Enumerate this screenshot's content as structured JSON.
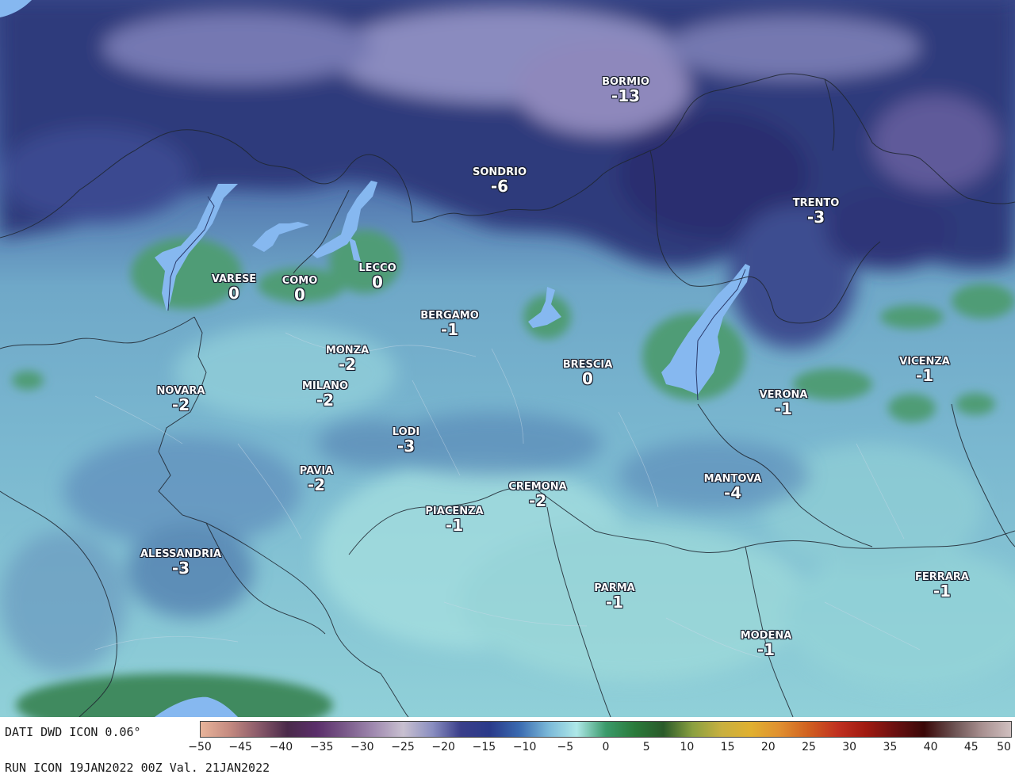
{
  "map": {
    "cities": [
      {
        "name": "BORMIO",
        "value": "-13"
      },
      {
        "name": "SONDRIO",
        "value": "-6"
      },
      {
        "name": "TRENTO",
        "value": "-3"
      },
      {
        "name": "VARESE",
        "value": "0"
      },
      {
        "name": "COMO",
        "value": "0"
      },
      {
        "name": "LECCO",
        "value": "0"
      },
      {
        "name": "BERGAMO",
        "value": "-1"
      },
      {
        "name": "BRESCIA",
        "value": "0"
      },
      {
        "name": "MONZA",
        "value": "-2"
      },
      {
        "name": "MILANO",
        "value": "-2"
      },
      {
        "name": "NOVARA",
        "value": "-2"
      },
      {
        "name": "VICENZA",
        "value": "-1"
      },
      {
        "name": "VERONA",
        "value": "-1"
      },
      {
        "name": "LODI",
        "value": "-3"
      },
      {
        "name": "PAVIA",
        "value": "-2"
      },
      {
        "name": "CREMONA",
        "value": "-2"
      },
      {
        "name": "PIACENZA",
        "value": "-1"
      },
      {
        "name": "MANTOVA",
        "value": "-4"
      },
      {
        "name": "ALESSANDRIA",
        "value": "-3"
      },
      {
        "name": "PARMA",
        "value": "-1"
      },
      {
        "name": "FERRARA",
        "value": "-1"
      },
      {
        "name": "MODENA",
        "value": "-1"
      }
    ]
  },
  "footer": {
    "source": "DATI DWD ICON 0.06°",
    "run": "RUN ICON 19JAN2022 00Z Val. 21JAN2022"
  },
  "colorbar": {
    "ticks": [
      "−50",
      "−45",
      "−40",
      "−35",
      "−30",
      "−25",
      "−20",
      "−15",
      "−10",
      "−5",
      "0",
      "5",
      "10",
      "15",
      "20",
      "25",
      "30",
      "35",
      "40",
      "45",
      "50"
    ],
    "colors": [
      "#e8b49a",
      "#c48a80",
      "#8a5a6a",
      "#4a2a4a",
      "#5a2e6a",
      "#7a5a8a",
      "#a08ab0",
      "#c8c0d0",
      "#8a8ec0",
      "#3a3e8a",
      "#2a3a8a",
      "#3a6ab0",
      "#7ab8d8",
      "#aee8e8",
      "#3a9a6a",
      "#2a7a3a",
      "#2a5a2a",
      "#8aa040",
      "#c8b040",
      "#e0b030",
      "#e09030",
      "#d06020",
      "#c03020",
      "#a01a10",
      "#6a1010",
      "#3a0808",
      "#6a5050",
      "#a89090",
      "#d0c0c0"
    ]
  }
}
